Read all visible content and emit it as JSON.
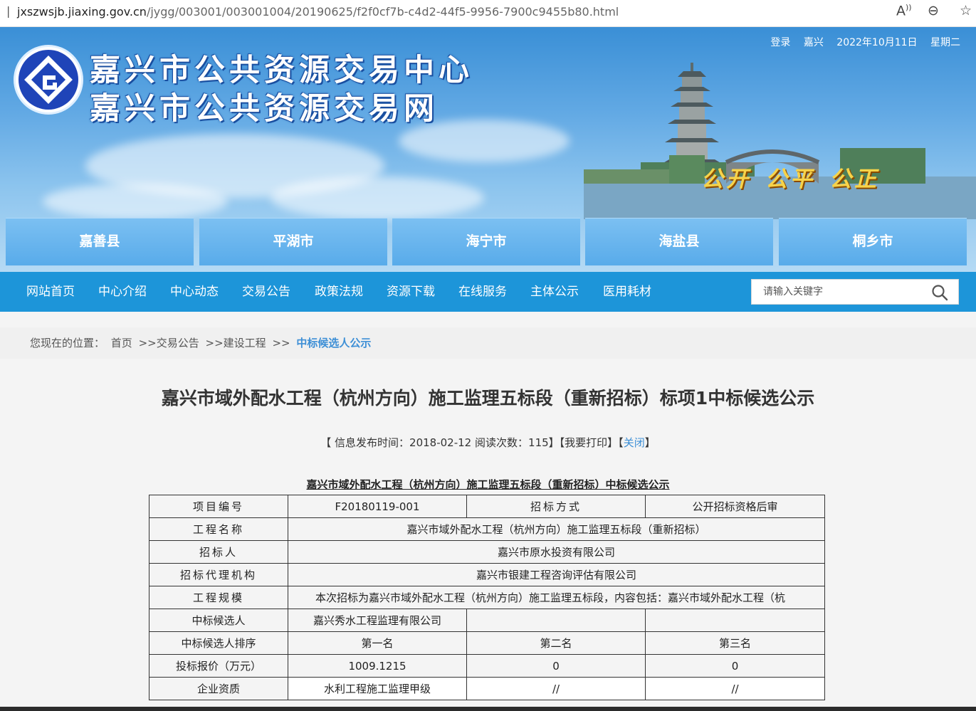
{
  "browser": {
    "url_host": "jxszwsjb.jiaxing.gov.cn",
    "url_path": "/jygg/003001/003001004/20190625/f2f0cf7b-c4d2-44f5-9956-7900c9455b80.html",
    "read_aloud_icon": "A",
    "zoom_icon": "⊖",
    "favorite_icon": "☆"
  },
  "header": {
    "site_name_1": "嘉兴市公共资源交易中心",
    "site_name_2": "嘉兴市公共资源交易网",
    "login": "登录",
    "city": "嘉兴",
    "date": "2022年10月11日",
    "weekday": "星期二",
    "slogan": [
      "公开",
      "公平",
      "公正"
    ]
  },
  "counties": [
    "嘉善县",
    "平湖市",
    "海宁市",
    "海盐县",
    "桐乡市"
  ],
  "nav": {
    "items": [
      "网站首页",
      "中心介绍",
      "中心动态",
      "交易公告",
      "政策法规",
      "资源下载",
      "在线服务",
      "主体公示",
      "医用耗材"
    ],
    "search_placeholder": "请输入关键字"
  },
  "breadcrumb": {
    "prefix": "您现在的位置：",
    "items": [
      "首页",
      ">>交易公告",
      ">>建设工程",
      ">>"
    ],
    "current": "中标候选人公示"
  },
  "article": {
    "title": "嘉兴市域外配水工程（杭州方向）施工监理五标段（重新招标）标项1中标候选公示",
    "meta_prefix": "【 信息发布时间：",
    "publish_date": "2018-02-12",
    "reads_label": "阅读次数：",
    "reads": "115",
    "meta_mid": "】【我要打印】【",
    "close": "关闭",
    "meta_end": "】",
    "table_caption": "嘉兴市域外配水工程（杭州方向）施工监理五标段（重新招标）中标候选公示"
  },
  "table": {
    "project_no_label": "项目编号",
    "project_no": "F20180119-001",
    "method_label": "招标方式",
    "method": "公开招标资格后审",
    "project_name_label": "工程名称",
    "project_name": "嘉兴市域外配水工程（杭州方向）施工监理五标段（重新招标）",
    "tenderer_label": "招标人",
    "tenderer": "嘉兴市原水投资有限公司",
    "agency_label": "招标代理机构",
    "agency": "嘉兴市银建工程咨询评估有限公司",
    "scale_label": "工程规模",
    "scale": "本次招标为嘉兴市域外配水工程（杭州方向）施工监理五标段，内容包括：嘉兴市域外配水工程（杭",
    "candidate_label": "中标候选人",
    "candidates": [
      "嘉兴秀水工程监理有限公司",
      "",
      ""
    ],
    "rank_label": "中标候选人排序",
    "ranks": [
      "第一名",
      "第二名",
      "第三名"
    ],
    "price_label": "投标报价（万元）",
    "prices": [
      "1009.1215",
      "0",
      "0"
    ],
    "qual_label": "企业资质",
    "quals": [
      "水利工程施工监理甲级",
      "//",
      "//"
    ]
  }
}
